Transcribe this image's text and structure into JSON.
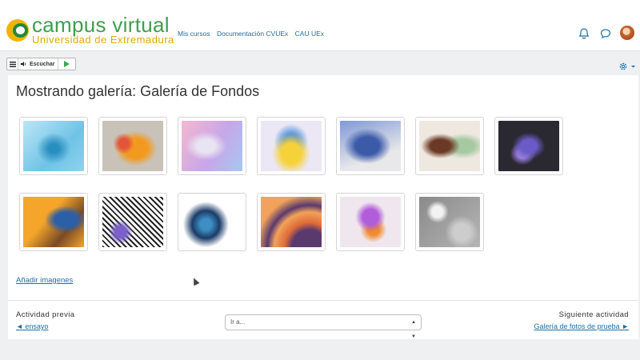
{
  "navbar": {
    "brand_title": "campus virtual",
    "brand_subtitle": "Universidad de Extremadura",
    "links": [
      "Mis cursos",
      "Documentación CVUEx",
      "CAU UEx"
    ],
    "icons": [
      "bell-icon",
      "chat-bubble-icon",
      "avatar"
    ]
  },
  "reader": {
    "menu_icon": "hamburger-icon",
    "speaker_icon": "speaker-icon",
    "label": "Escuchar",
    "play_icon": "play-icon"
  },
  "page": {
    "title": "Mostrando galería: Galería de Fondos",
    "settings_icon": "gear-icon",
    "add_images": "Añadir imagenes"
  },
  "gallery": {
    "rows": [
      [
        {
          "name": "blue splash",
          "colors": [
            "#6fc3e6",
            "#2a8fbf",
            "#bde6f6"
          ]
        },
        {
          "name": "orange coral",
          "colors": [
            "#c9c2b8",
            "#f29a1f",
            "#e2553a"
          ]
        },
        {
          "name": "pastel swirl",
          "colors": [
            "#c7a6e9",
            "#f5b8d0",
            "#e9e4f2"
          ]
        },
        {
          "name": "yellow ribbon",
          "colors": [
            "#ece7f4",
            "#f6d23a",
            "#4a8fe0"
          ]
        },
        {
          "name": "blue feathers",
          "colors": [
            "#e8e8ea",
            "#3b5aa8",
            "#7f98d6"
          ]
        },
        {
          "name": "brown spirals",
          "colors": [
            "#efe8e0",
            "#6b3a24",
            "#a5c9a0"
          ]
        },
        {
          "name": "purple crystals",
          "colors": [
            "#2a2830",
            "#6a5bc6",
            "#9e7ee0"
          ]
        }
      ],
      [
        {
          "name": "orange landscape",
          "colors": [
            "#f4a52a",
            "#2b5fa8",
            "#7a4a25"
          ]
        },
        {
          "name": "black white pattern",
          "colors": [
            "#ffffff",
            "#222222",
            "#7a60c8"
          ]
        },
        {
          "name": "blue flower",
          "colors": [
            "#ffffff",
            "#1b3c68",
            "#3e8ec4"
          ]
        },
        {
          "name": "orange arcs",
          "colors": [
            "#f2a25a",
            "#5a3a6e",
            "#e06a38"
          ]
        },
        {
          "name": "purple flowers",
          "colors": [
            "#efe6ee",
            "#b15cd8",
            "#f08a2e"
          ]
        },
        {
          "name": "grey spheres",
          "colors": [
            "#8a8a8a",
            "#cdcdcd",
            "#f2f2f2"
          ]
        }
      ]
    ]
  },
  "footer": {
    "prev_label": "Actividad previa",
    "prev_link": "◄ ensayo",
    "goto_placeholder": "Ir a...",
    "next_label": "Siguiente actividad",
    "next_link": "Galería de fotos de prueba ►"
  }
}
